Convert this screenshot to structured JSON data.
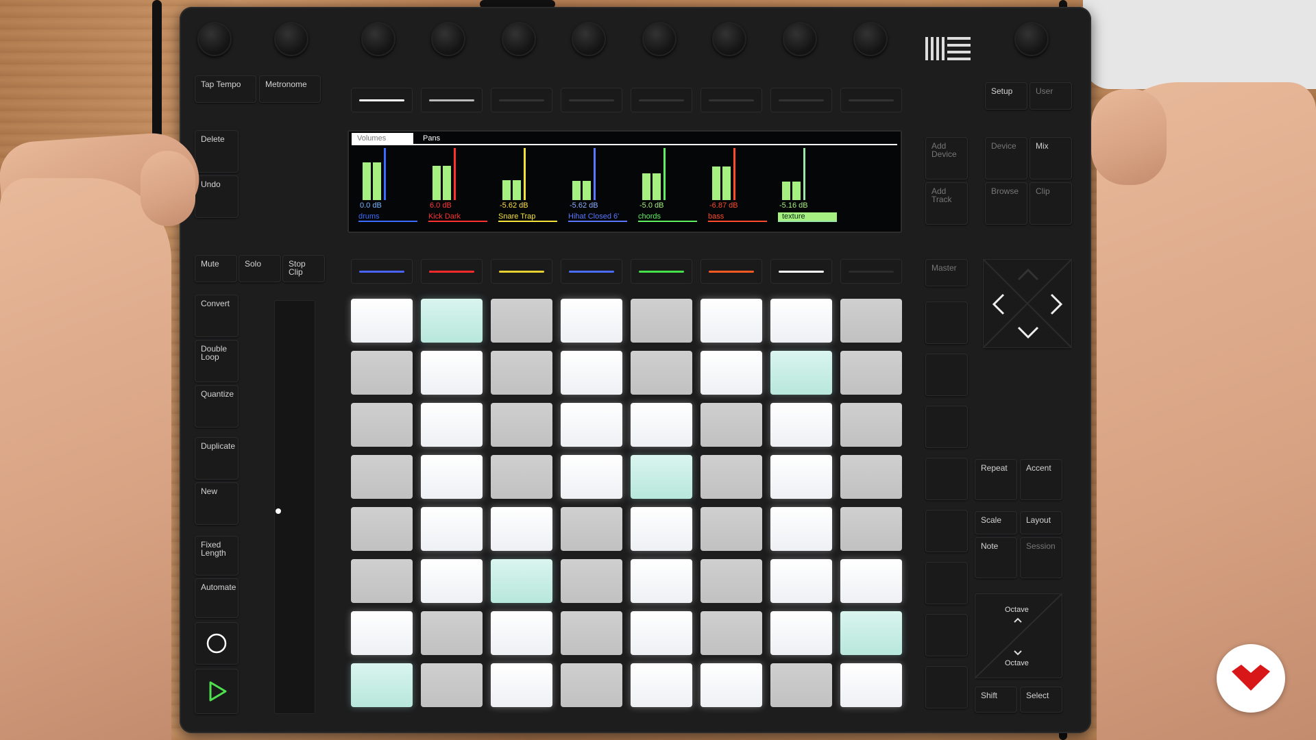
{
  "top_row_left": [
    "Tap Tempo",
    "Metronome"
  ],
  "top_row_right": [
    "Setup",
    "User"
  ],
  "left_buttons": [
    "Delete",
    "Undo"
  ],
  "mute_row": [
    "Mute",
    "Solo",
    "Stop\nClip"
  ],
  "side_buttons": [
    "Convert",
    "Double\nLoop",
    "Quantize",
    "Duplicate",
    "New",
    "Fixed\nLength",
    "Automate"
  ],
  "right_mode_buttons": [
    "Add\nDevice",
    "Add\nTrack",
    "Device",
    "Mix",
    "Browse",
    "Clip",
    "Master"
  ],
  "lower_right": [
    "Repeat",
    "Accent",
    "Scale",
    "Layout",
    "Note",
    "Session",
    "Octave",
    "Octave",
    "Shift",
    "Select"
  ],
  "display": {
    "tabs": [
      "Volumes",
      "Pans"
    ],
    "active_tab": "Volumes",
    "tracks": [
      {
        "name": "drums",
        "db": "0.0 dB",
        "level": 0.78,
        "color": "#3a6cff",
        "db_color": "#7ab8ff"
      },
      {
        "name": "Kick Dark",
        "db": "6.0 dB",
        "level": 0.72,
        "color": "#ff3030",
        "db_color": "#ff3a3a"
      },
      {
        "name": "Snare Trap",
        "db": "-5.62 dB",
        "level": 0.42,
        "color": "#f4e23a",
        "db_color": "#ffe34a"
      },
      {
        "name": "Hihat Closed 6'",
        "db": "-5.62 dB",
        "level": 0.4,
        "color": "#5a78ff",
        "db_color": "#8ab0ff"
      },
      {
        "name": "chords",
        "db": "-5.0 dB",
        "level": 0.55,
        "color": "#5ef060",
        "db_color": "#a6f081"
      },
      {
        "name": "bass",
        "db": "-6.87 dB",
        "level": 0.7,
        "color": "#ff4b2b",
        "db_color": "#ff4b2b"
      },
      {
        "name": "texture",
        "db": "-5.16 dB",
        "level": 0.38,
        "color": "#9ae6a8",
        "db_color": "#a6f081"
      }
    ]
  },
  "track_strip_colors": [
    "#4a63ff",
    "#ff2a2a",
    "#e6d032",
    "#4a6dff",
    "#46e04a",
    "#ff5a22",
    "#ffffff",
    "#2b2b2b"
  ],
  "top_strip_colors": [
    "#ffffff",
    "#bbbbbb",
    "#333333",
    "#333333",
    "#333333",
    "#333333",
    "#333333",
    "#333333"
  ],
  "pad_grid": [
    [
      "w",
      "t",
      "g",
      "w",
      "g",
      "w",
      "w",
      "g"
    ],
    [
      "g",
      "w",
      "g",
      "w",
      "g",
      "w",
      "t",
      "g"
    ],
    [
      "g",
      "w",
      "g",
      "w",
      "w",
      "g",
      "w",
      "g"
    ],
    [
      "g",
      "w",
      "g",
      "w",
      "t",
      "g",
      "w",
      "g"
    ],
    [
      "g",
      "w",
      "w",
      "g",
      "w",
      "g",
      "w",
      "g"
    ],
    [
      "g",
      "w",
      "t",
      "g",
      "w",
      "g",
      "w",
      "w"
    ],
    [
      "w",
      "g",
      "w",
      "g",
      "w",
      "g",
      "w",
      "t"
    ],
    [
      "t",
      "g",
      "w",
      "g",
      "w",
      "w",
      "g",
      "w"
    ]
  ]
}
